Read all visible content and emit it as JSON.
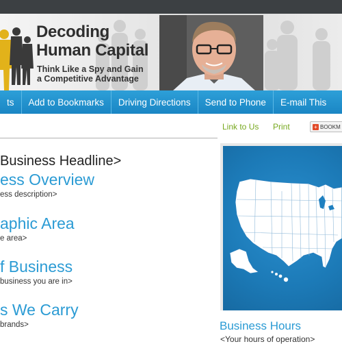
{
  "brand": {
    "title_line1": "Decoding",
    "title_line2": "Human Capital",
    "tagline_line1": "Think Like a Spy and Gain",
    "tagline_line2": "a Competitive Advantage"
  },
  "nav": {
    "items": [
      {
        "label": "ts"
      },
      {
        "label": "Add to Bookmarks"
      },
      {
        "label": "Driving Directions"
      },
      {
        "label": "Send to Phone"
      },
      {
        "label": "E-mail This"
      }
    ]
  },
  "utility": {
    "link_to_us": "Link to Us",
    "print": "Print",
    "bookmark": "BOOKM"
  },
  "main": {
    "headline": "Business Headline>",
    "sections": [
      {
        "title": "ess Overview",
        "desc": "ess description>"
      },
      {
        "title": "aphic Area",
        "desc": "e area>"
      },
      {
        "title": "f Business",
        "desc": "business you are in>"
      },
      {
        "title": "s We Carry",
        "desc": "brands>"
      }
    ]
  },
  "sidebar": {
    "hours_title": "Business Hours",
    "hours_desc": "<Your hours of operation>"
  },
  "colors": {
    "nav_blue": "#1a86c4",
    "link_blue": "#2b9bd4",
    "link_green": "#77a81f",
    "topbar": "#3c4043"
  }
}
